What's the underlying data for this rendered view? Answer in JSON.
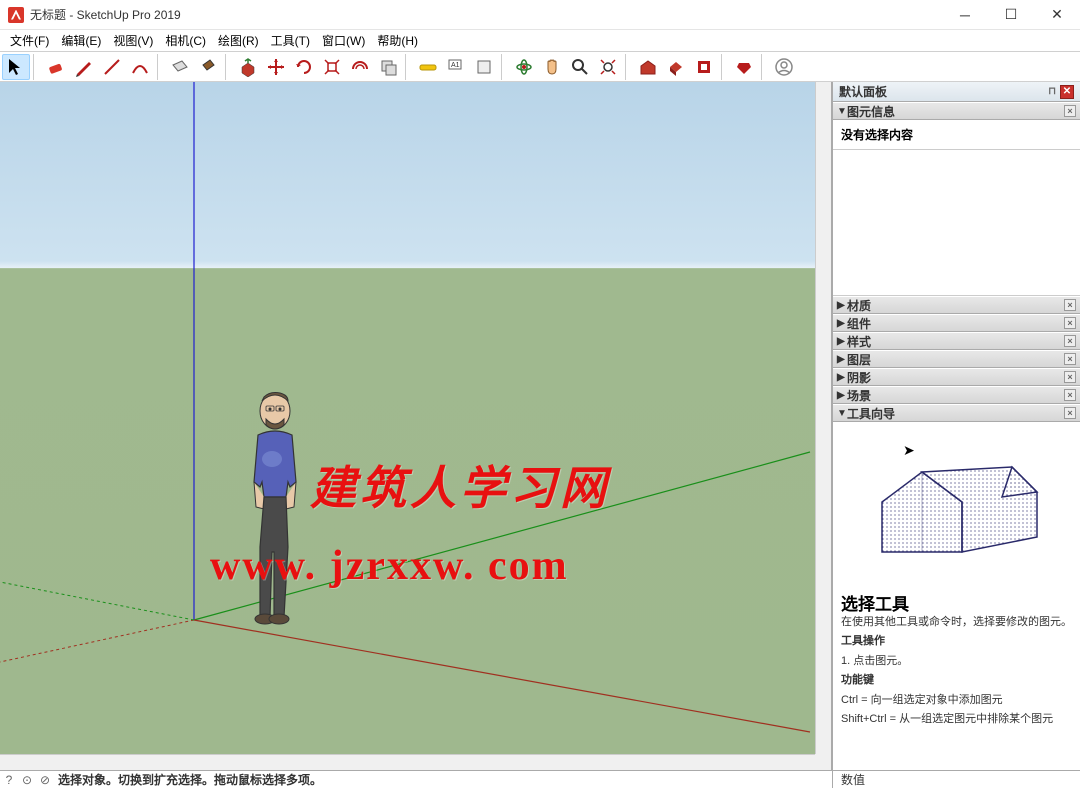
{
  "titlebar": {
    "title": "无标题 - SketchUp Pro 2019"
  },
  "menubar": {
    "items": [
      "文件(F)",
      "编辑(E)",
      "视图(V)",
      "相机(C)",
      "绘图(R)",
      "工具(T)",
      "窗口(W)",
      "帮助(H)"
    ]
  },
  "toolbar": {
    "icons": [
      "select-arrow",
      "eraser",
      "pencil",
      "line",
      "arc",
      "rectangle",
      "paint-bucket",
      "push-pull",
      "move",
      "rotate",
      "scale",
      "offset",
      "follow-me",
      "tape-measure",
      "dimension",
      "text",
      "protractor",
      "orbit",
      "pan",
      "zoom",
      "zoom-extents",
      "warehouse",
      "extension",
      "layers",
      "ruby",
      "user"
    ]
  },
  "panel": {
    "title": "默认面板",
    "sections": {
      "entity_info": {
        "label": "图元信息",
        "body": "没有选择内容"
      },
      "materials": "材质",
      "components": "组件",
      "styles": "样式",
      "layers": "图层",
      "shadows": "阴影",
      "scenes": "场景",
      "instructor": "工具向导"
    },
    "instructor_content": {
      "tool_title": "选择工具",
      "tool_desc": "在使用其他工具或命令时，选择要修改的图元。",
      "op_title": "工具操作",
      "op_item1": "1. 点击图元。",
      "keys_title": "功能键",
      "keys_ctrl": "Ctrl = 向一组选定对象中添加图元",
      "keys_shift": "Shift+Ctrl = 从一组选定图元中排除某个图元"
    }
  },
  "statusbar": {
    "hint": "选择对象。切换到扩充选择。拖动鼠标选择多项。",
    "right_label": "数值"
  },
  "watermark": {
    "line1": "建筑人学习网",
    "line2": "www. jzrxxw. com"
  }
}
